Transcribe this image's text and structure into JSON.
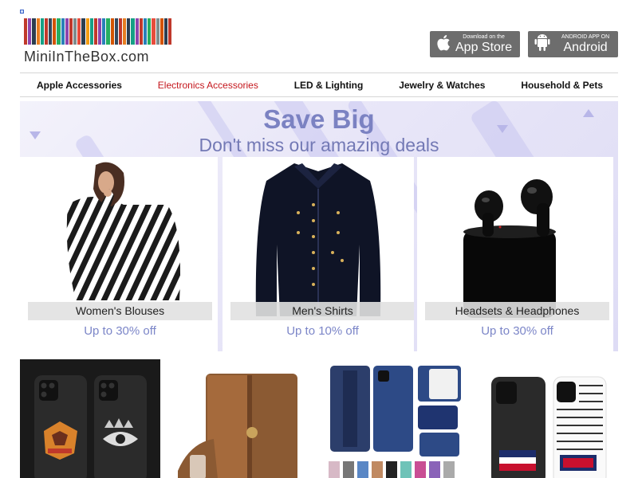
{
  "header": {
    "logo_text": "MiniInTheBox.com",
    "logo_bar_colors": [
      "#c0392b",
      "#8e44ad",
      "#2c3e50",
      "#e67e22",
      "#16a085",
      "#c0392b",
      "#34495e",
      "#d35400",
      "#27ae60",
      "#2980b9",
      "#8e44ad",
      "#c0392b",
      "#7f8c8d",
      "#e74c3c",
      "#2c3e50",
      "#f39c12",
      "#16a085",
      "#c0392b",
      "#8e44ad",
      "#2980b9",
      "#27ae60",
      "#d35400",
      "#34495e",
      "#c0392b",
      "#e67e22",
      "#2c3e50",
      "#16a085",
      "#8e44ad",
      "#c0392b",
      "#2980b9",
      "#27ae60",
      "#e74c3c",
      "#7f8c8d",
      "#d35400",
      "#2c3e50",
      "#c0392b"
    ],
    "app_store": {
      "small": "Download on the",
      "big": "App Store",
      "icon": "apple-icon"
    },
    "android": {
      "small": "ANDROID APP ON",
      "big": "Android",
      "icon": "android-icon"
    }
  },
  "nav": {
    "items": [
      {
        "label": "Apple Accessories",
        "active": false
      },
      {
        "label": "Electronics Accessories",
        "active": true
      },
      {
        "label": "LED & Lighting",
        "active": false
      },
      {
        "label": "Jewelry & Watches",
        "active": false
      },
      {
        "label": "Household & Pets",
        "active": false
      }
    ],
    "active_color": "#c4161c"
  },
  "banner": {
    "title": "Save Big",
    "subtitle": "Don't miss our amazing deals",
    "title_color": "#7b82c2",
    "cards": [
      {
        "label": "Women's Blouses",
        "discount": "Up to 30% off",
        "image": "womens-blouse-image"
      },
      {
        "label": "Men's Shirts",
        "discount": "Up to 10% off",
        "image": "mens-shirt-image"
      },
      {
        "label": "Headsets & Headphones",
        "discount": "Up to 30% off",
        "image": "earbuds-image"
      }
    ]
  },
  "products": [
    {
      "image": "phone-case-tiger-eye-image"
    },
    {
      "image": "leather-wallet-case-image"
    },
    {
      "image": "blue-wallet-case-image"
    },
    {
      "image": "tommy-hilfiger-case-image"
    }
  ]
}
